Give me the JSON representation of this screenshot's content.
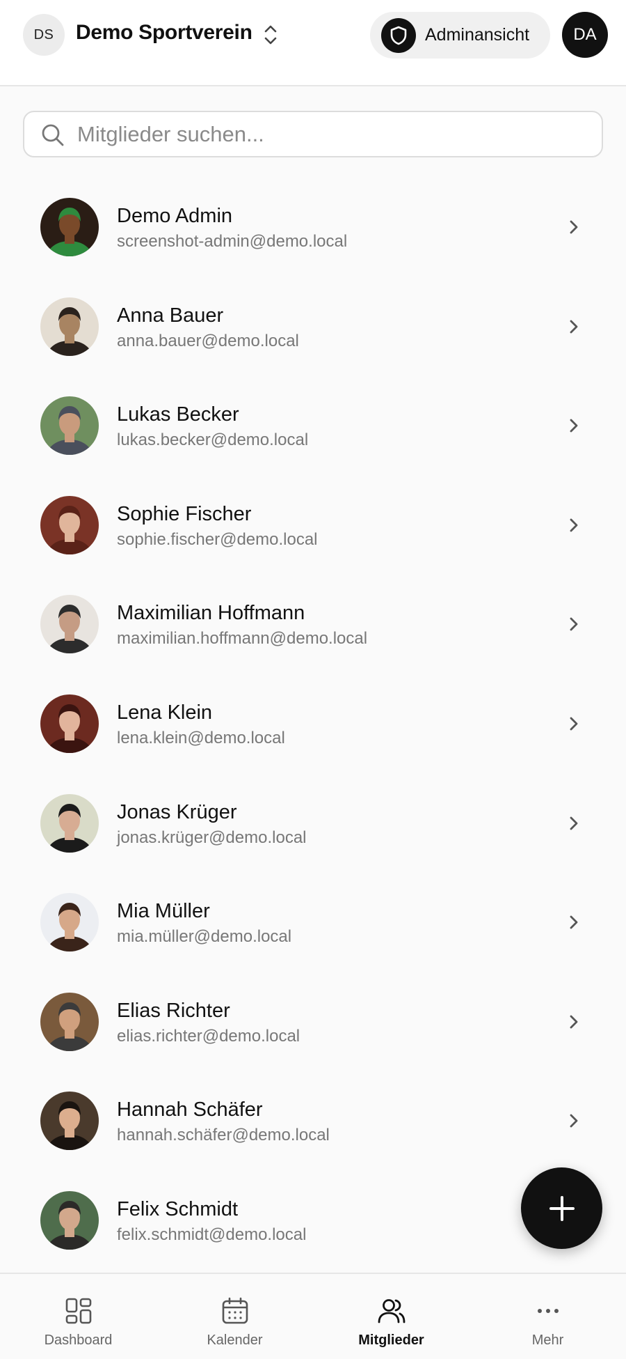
{
  "header": {
    "org_initials": "DS",
    "org_name": "Demo Sportverein",
    "admin_view_label": "Adminansicht",
    "user_initials": "DA"
  },
  "search": {
    "placeholder": "Mitglieder suchen..."
  },
  "members": [
    {
      "name": "Demo Admin",
      "email": "screenshot-admin@demo.local",
      "photo_colors": [
        "#2a1d15",
        "#7a4a2a",
        "#2e8b3e"
      ]
    },
    {
      "name": "Anna Bauer",
      "email": "anna.bauer@demo.local",
      "photo_colors": [
        "#e4ddd2",
        "#a88462",
        "#2a221d"
      ]
    },
    {
      "name": "Lukas Becker",
      "email": "lukas.becker@demo.local",
      "photo_colors": [
        "#6f8f5f",
        "#c99b7d",
        "#4a4f5c"
      ]
    },
    {
      "name": "Sophie Fischer",
      "email": "sophie.fischer@demo.local",
      "photo_colors": [
        "#7a3326",
        "#e0b59b",
        "#5a2218"
      ]
    },
    {
      "name": "Maximilian Hoffmann",
      "email": "maximilian.hoffmann@demo.local",
      "photo_colors": [
        "#e8e4df",
        "#c59c84",
        "#2c2c2c"
      ]
    },
    {
      "name": "Lena Klein",
      "email": "lena.klein@demo.local",
      "photo_colors": [
        "#6c2a20",
        "#e2b49c",
        "#3b1410"
      ]
    },
    {
      "name": "Jonas Krüger",
      "email": "jonas.krüger@demo.local",
      "photo_colors": [
        "#d9dbc8",
        "#d7ac93",
        "#1b1b1b"
      ]
    },
    {
      "name": "Mia Müller",
      "email": "mia.müller@demo.local",
      "photo_colors": [
        "#eceef2",
        "#d6a889",
        "#3a241a"
      ]
    },
    {
      "name": "Elias Richter",
      "email": "elias.richter@demo.local",
      "photo_colors": [
        "#7a5a3c",
        "#d0a07e",
        "#3b3b3b"
      ]
    },
    {
      "name": "Hannah Schäfer",
      "email": "hannah.schäfer@demo.local",
      "photo_colors": [
        "#4a3a2c",
        "#dcae8e",
        "#1a1410"
      ]
    },
    {
      "name": "Felix Schmidt",
      "email": "felix.schmidt@demo.local",
      "photo_colors": [
        "#4f6d4c",
        "#d2a88c",
        "#2b2a28"
      ]
    }
  ],
  "nav": [
    {
      "label": "Dashboard",
      "icon": "dashboard-icon",
      "active": false
    },
    {
      "label": "Kalender",
      "icon": "calendar-icon",
      "active": false
    },
    {
      "label": "Mitglieder",
      "icon": "members-icon",
      "active": true
    },
    {
      "label": "Mehr",
      "icon": "more-icon",
      "active": false
    }
  ],
  "fab": {
    "icon": "plus-icon"
  },
  "colors": {
    "accent": "#111111",
    "background": "#fafafa",
    "muted_text": "#777777"
  }
}
